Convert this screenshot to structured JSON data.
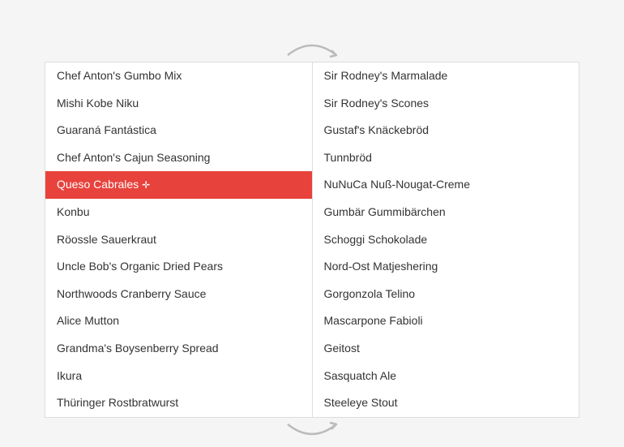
{
  "leftList": {
    "items": [
      {
        "label": "Chef Anton's Gumbo Mix",
        "selected": false
      },
      {
        "label": "Mishi Kobe Niku",
        "selected": false
      },
      {
        "label": "Guaraná Fantástica",
        "selected": false
      },
      {
        "label": "Chef Anton's Cajun Seasoning",
        "selected": false
      },
      {
        "label": "Queso Cabrales",
        "selected": true
      },
      {
        "label": "Konbu",
        "selected": false
      },
      {
        "label": "Röossle Sauerkraut",
        "selected": false
      },
      {
        "label": "Uncle Bob's Organic Dried Pears",
        "selected": false
      },
      {
        "label": "Northwoods Cranberry Sauce",
        "selected": false
      },
      {
        "label": "Alice Mutton",
        "selected": false
      },
      {
        "label": "Grandma's Boysenberry Spread",
        "selected": false
      },
      {
        "label": "Ikura",
        "selected": false
      },
      {
        "label": "Thüringer Rostbratwurst",
        "selected": false
      }
    ]
  },
  "rightList": {
    "items": [
      {
        "label": "Sir Rodney's Marmalade",
        "selected": false
      },
      {
        "label": "Sir Rodney's Scones",
        "selected": false
      },
      {
        "label": "Gustaf's Knäckebröd",
        "selected": false
      },
      {
        "label": "Tunnbröd",
        "selected": false
      },
      {
        "label": "NuNuCa Nuß-Nougat-Creme",
        "selected": false
      },
      {
        "label": "Gumbär Gummibärchen",
        "selected": false
      },
      {
        "label": "Schoggi Schokolade",
        "selected": false
      },
      {
        "label": "Nord-Ost Matjeshering",
        "selected": false
      },
      {
        "label": "Gorgonzola Telino",
        "selected": false
      },
      {
        "label": "Mascarpone Fabioli",
        "selected": false
      },
      {
        "label": "Geitost",
        "selected": false
      },
      {
        "label": "Sasquatch Ale",
        "selected": false
      },
      {
        "label": "Steeleye Stout",
        "selected": false
      }
    ]
  }
}
